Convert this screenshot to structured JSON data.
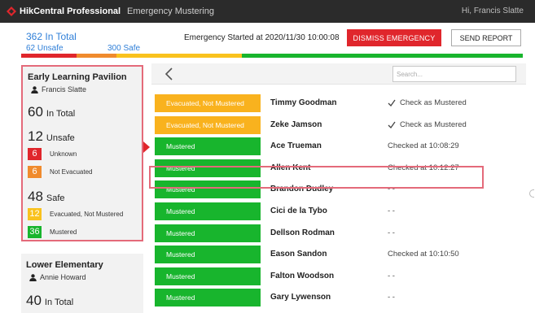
{
  "header": {
    "app_name": "HikCentral Professional",
    "module": "Emergency Mustering",
    "user_greeting": "Hi, Francis Slatte"
  },
  "summary": {
    "total": "362 In Total",
    "unsafe": "62 Unsafe",
    "safe": "300 Safe",
    "started": "Emergency Started at 2020/11/30 10:00:08",
    "dismiss_label": "DISMISS EMERGENCY",
    "report_label": "SEND REPORT",
    "progress": [
      {
        "fraction": 0.11,
        "color": "#e0262c"
      },
      {
        "fraction": 0.08,
        "color": "#f08b2d"
      },
      {
        "fraction": 0.25,
        "color": "#f9c21e"
      },
      {
        "fraction": 0.56,
        "color": "#18b52d"
      }
    ]
  },
  "colors": {
    "unknown": "#e0262c",
    "not_evacuated": "#f08b2d",
    "evacuated_not_mustered": "#f9b21e",
    "mustered": "#18b52d",
    "accent": "#2f7fd8"
  },
  "groups": [
    {
      "title": "Early Learning Pavilion",
      "person": "Francis Slatte",
      "total_num": "60",
      "total_label": "In Total",
      "unsafe_num": "12",
      "unsafe_label": "Unsafe",
      "unknown_num": "6",
      "unknown_label": "Unknown",
      "not_evacuated_num": "6",
      "not_evacuated_label": "Not Evacuated",
      "safe_num": "48",
      "safe_label": "Safe",
      "evac_num": "12",
      "evac_label": "Evacuated, Not Mustered",
      "mustered_num": "36",
      "mustered_label": "Mustered"
    },
    {
      "title": "Lower Elementary",
      "person": "Annie Howard",
      "total_num": "40",
      "total_label": "In Total"
    }
  ],
  "list": {
    "search_placeholder": "Search...",
    "rows": [
      {
        "status": "Evacuated, Not Mustered",
        "color": "yellow",
        "name": "Timmy Goodman",
        "detail": "Check as Mustered",
        "check": true
      },
      {
        "status": "Evacuated, Not Mustered",
        "color": "yellow",
        "name": "Zeke Jamson",
        "detail": "Check as Mustered",
        "check": true
      },
      {
        "status": "Mustered",
        "color": "green",
        "name": "Ace Trueman",
        "detail": "Checked at 10:08:29",
        "check": false
      },
      {
        "status": "Mustered",
        "color": "green",
        "name": "Allen Kent",
        "detail": "Checked at 10:12:27",
        "check": false
      },
      {
        "status": "Mustered",
        "color": "green",
        "name": "Brandon Dudley",
        "detail": "- -",
        "check": false
      },
      {
        "status": "Mustered",
        "color": "green",
        "name": "Cici de la Tybo",
        "detail": "- -",
        "check": false
      },
      {
        "status": "Mustered",
        "color": "green",
        "name": "Dellson Rodman",
        "detail": "- -",
        "check": false
      },
      {
        "status": "Mustered",
        "color": "green",
        "name": "Eason Sandon",
        "detail": "Checked at 10:10:50",
        "check": false
      },
      {
        "status": "Mustered",
        "color": "green",
        "name": "Falton Woodson",
        "detail": "- -",
        "check": false
      },
      {
        "status": "Mustered",
        "color": "green",
        "name": "Gary Lywenson",
        "detail": "- -",
        "check": false
      }
    ]
  }
}
